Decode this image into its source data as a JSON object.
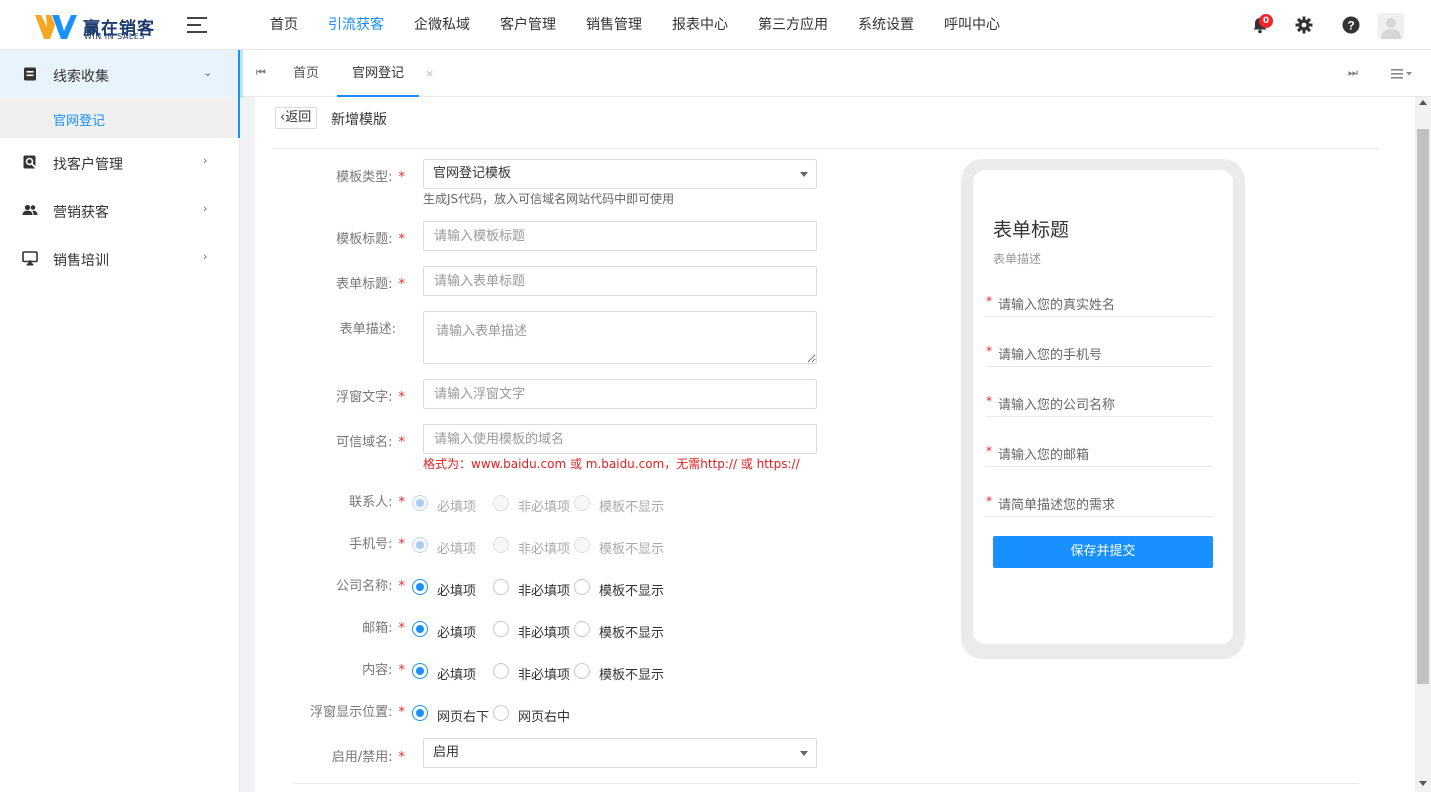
{
  "brand": {
    "name": "赢在销客",
    "sub": "WIN IN SALES"
  },
  "nav": [
    {
      "label": "首页",
      "active": false
    },
    {
      "label": "引流获客",
      "active": true
    },
    {
      "label": "企微私域",
      "active": false
    },
    {
      "label": "客户管理",
      "active": false
    },
    {
      "label": "销售管理",
      "active": false
    },
    {
      "label": "报表中心",
      "active": false
    },
    {
      "label": "第三方应用",
      "active": false
    },
    {
      "label": "系统设置",
      "active": false
    },
    {
      "label": "呼叫中心",
      "active": false
    }
  ],
  "header": {
    "icons": [
      "moon-icon",
      "bell-icon",
      "gear-icon",
      "help-icon",
      "avatar"
    ],
    "notification_count": "0"
  },
  "sidebar": {
    "items": [
      {
        "label": "线索收集",
        "icon": "clipboard-icon",
        "expanded": true
      },
      {
        "label": "找客户管理",
        "icon": "search-doc-icon",
        "expanded": false
      },
      {
        "label": "营销获客",
        "icon": "users-icon",
        "expanded": false
      },
      {
        "label": "销售培训",
        "icon": "training-screen-icon",
        "expanded": false
      }
    ],
    "sub_item": "官网登记"
  },
  "tabs": {
    "items": [
      {
        "label": "首页",
        "active": false
      },
      {
        "label": "官网登记",
        "active": true
      }
    ],
    "close_glyph": "×"
  },
  "page": {
    "back_label": "返回",
    "title": "新增模版"
  },
  "form": {
    "required_mark": "*",
    "template_type": {
      "label": "模板类型:",
      "value": "官网登记模板",
      "hint": "生成JS代码，放入可信域名网站代码中即可使用"
    },
    "template_title": {
      "label": "模板标题:",
      "placeholder": "请输入模板标题"
    },
    "form_title": {
      "label": "表单标题:",
      "placeholder": "请输入表单标题"
    },
    "form_desc": {
      "label": "表单描述:",
      "placeholder": "请输入表单描述"
    },
    "float_text": {
      "label": "浮窗文字:",
      "placeholder": "请输入浮窗文字"
    },
    "trusted_domain": {
      "label": "可信域名:",
      "placeholder": "请输入使用模板的域名",
      "warning": "格式为：www.baidu.com 或 m.baidu.com，无需http:// 或 https://"
    },
    "radio_options": [
      "必填项",
      "非必填项",
      "模板不显示"
    ],
    "field_rows": [
      {
        "label": "联系人:",
        "selected": 0,
        "disabled": true
      },
      {
        "label": "手机号:",
        "selected": 0,
        "disabled": true
      },
      {
        "label": "公司名称:",
        "selected": 0,
        "disabled": false
      },
      {
        "label": "邮箱:",
        "selected": 0,
        "disabled": false
      },
      {
        "label": "内容:",
        "selected": 0,
        "disabled": false
      }
    ],
    "float_position": {
      "label": "浮窗显示位置:",
      "options": [
        "网页右下",
        "网页右中"
      ],
      "selected": 0
    },
    "enable": {
      "label": "启用/禁用:",
      "value": "启用"
    }
  },
  "preview": {
    "title": "表单标题",
    "desc": "表单描述",
    "fields": [
      "请输入您的真实姓名",
      "请输入您的手机号",
      "请输入您的公司名称",
      "请输入您的邮箱",
      "请简单描述您的需求"
    ],
    "submit": "保存并提交"
  },
  "colors": {
    "accent": "#1890ff",
    "required": "#f5222d",
    "warning": "#e02020"
  }
}
